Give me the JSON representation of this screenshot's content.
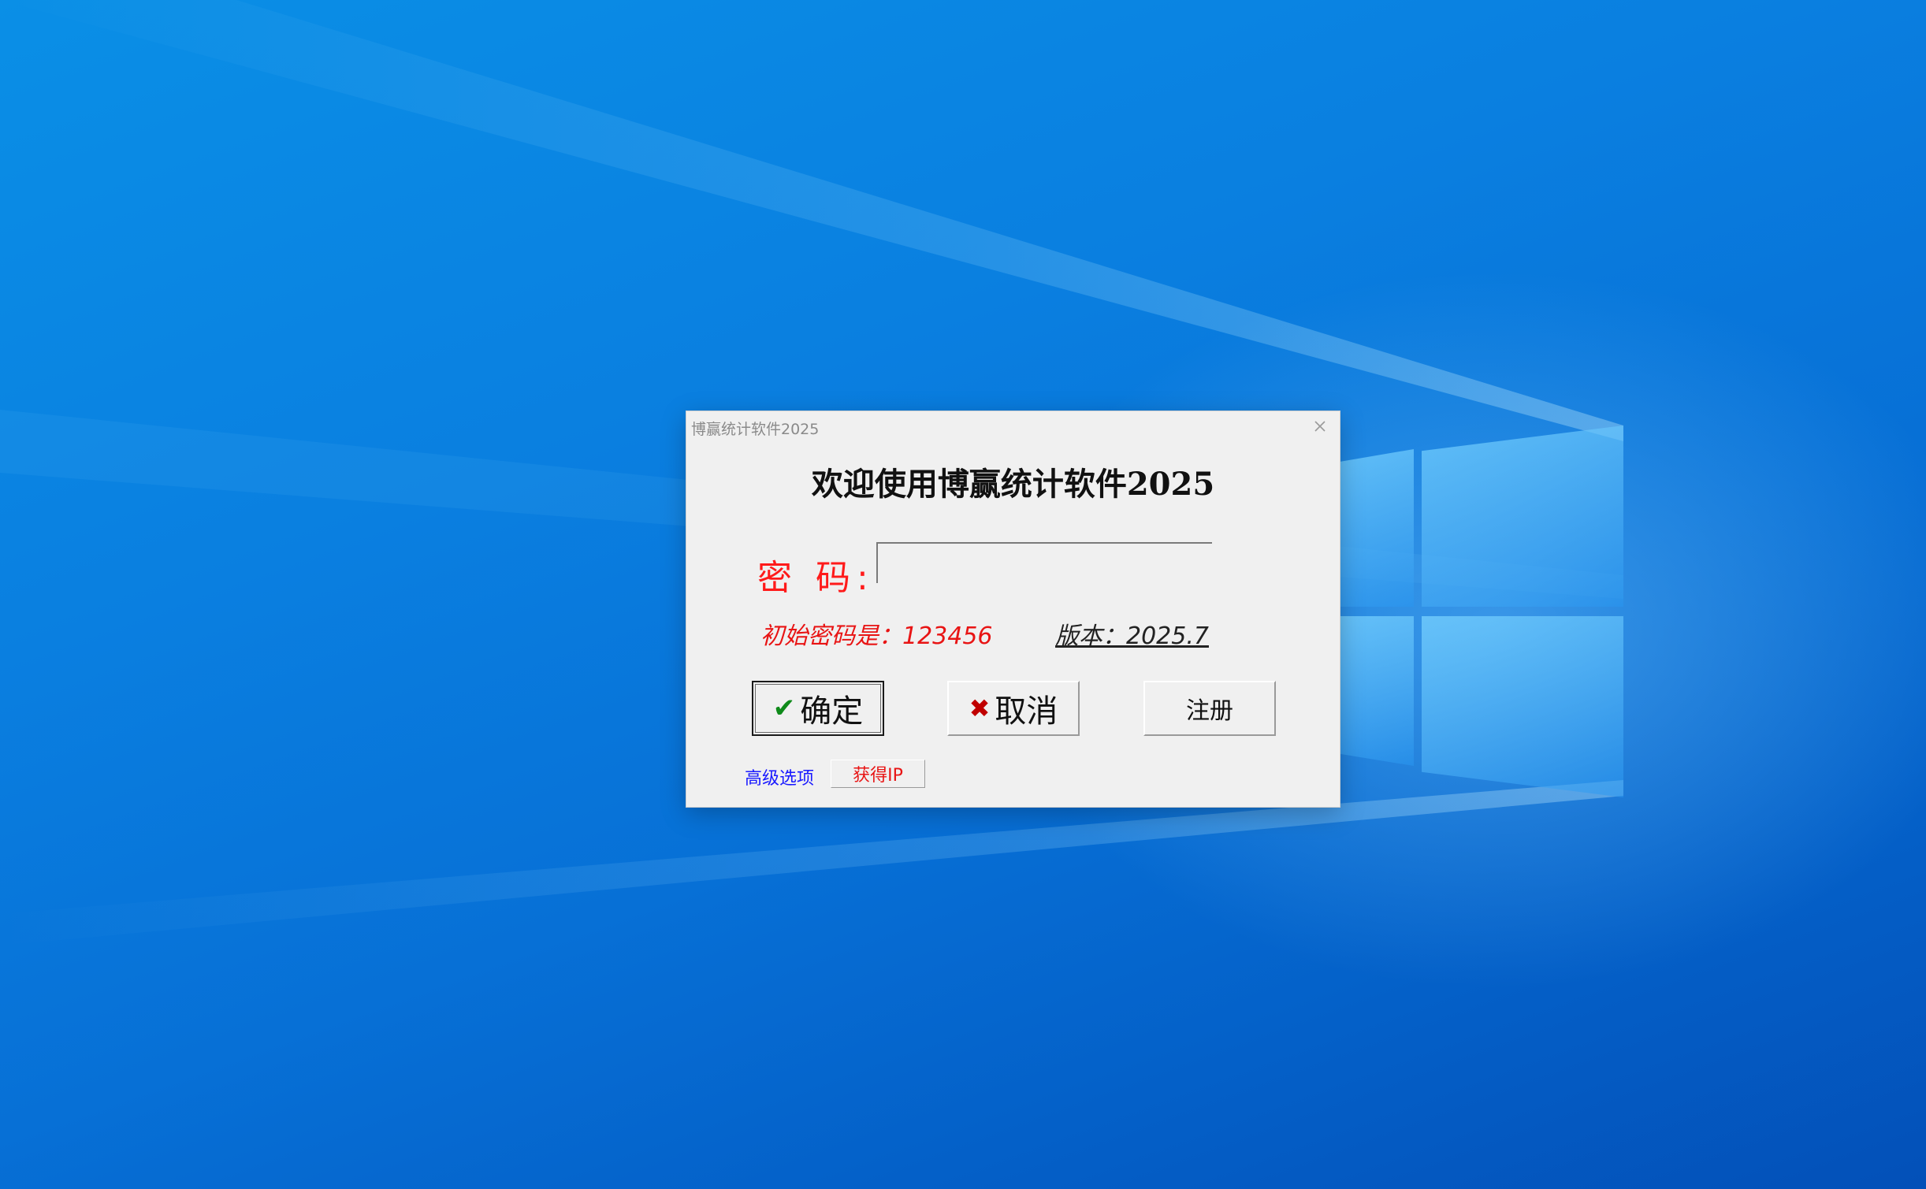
{
  "window": {
    "title": "博赢统计软件2025",
    "close_glyph": "×"
  },
  "login": {
    "welcome": "欢迎使用博赢统计软件2025",
    "password_label": "密 码:",
    "password_value": "",
    "initial_password_hint": "初始密码是：123456",
    "version": "版本：2025.7"
  },
  "buttons": {
    "ok": {
      "icon": "check-icon",
      "icon_glyph": "✔",
      "label": "确定"
    },
    "cancel": {
      "icon": "cross-icon",
      "icon_glyph": "✖",
      "label": "取消"
    },
    "register": {
      "label": "注册"
    }
  },
  "footer": {
    "advanced_options": "高级选项",
    "get_ip": "获得IP"
  },
  "colors": {
    "accent_red": "#ff1a1a",
    "link_blue": "#1a1aff",
    "dialog_bg": "#f0f0f0"
  }
}
